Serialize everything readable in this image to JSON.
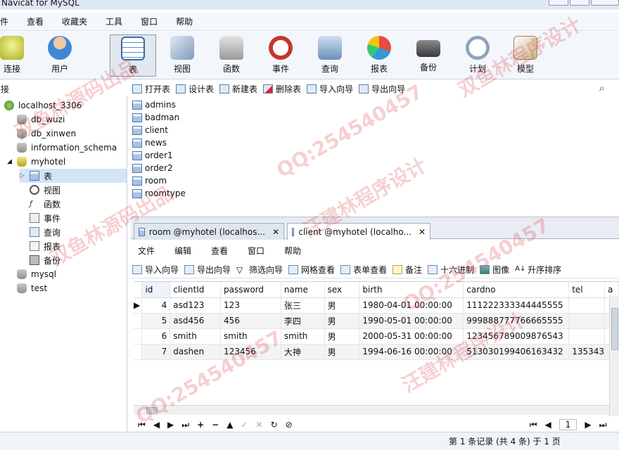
{
  "window": {
    "title": "Navicat for MySQL"
  },
  "menu": [
    "件",
    "查看",
    "收藏夹",
    "工具",
    "窗口",
    "帮助"
  ],
  "toolbar": [
    {
      "label": "连接",
      "icon": "connection-icon"
    },
    {
      "label": "用户",
      "icon": "user-icon"
    },
    {
      "label": "表",
      "icon": "table-icon",
      "active": true
    },
    {
      "label": "视图",
      "icon": "view-icon"
    },
    {
      "label": "函数",
      "icon": "function-icon"
    },
    {
      "label": "事件",
      "icon": "event-icon"
    },
    {
      "label": "查询",
      "icon": "query-icon"
    },
    {
      "label": "报表",
      "icon": "report-icon"
    },
    {
      "label": "备份",
      "icon": "backup-icon"
    },
    {
      "label": "计划",
      "icon": "schedule-icon"
    },
    {
      "label": "模型",
      "icon": "model-icon"
    }
  ],
  "left_title": "接",
  "tree": {
    "connection": "localhost_3306",
    "databases": [
      "db_wuzi",
      "db_xinwen",
      "information_schema",
      "myhotel",
      "mysql",
      "test"
    ],
    "myhotel_children": [
      "表",
      "视图",
      "函数",
      "事件",
      "查询",
      "报表",
      "备份"
    ]
  },
  "object_toolbar": [
    "打开表",
    "设计表",
    "新建表",
    "删除表",
    "导入向导",
    "导出向导"
  ],
  "tables": [
    "admins",
    "badman",
    "client",
    "news",
    "order1",
    "order2",
    "room",
    "roomtype"
  ],
  "tabs": [
    {
      "label": "room @myhotel (localhos...",
      "close": "✕"
    },
    {
      "label": "client @myhotel (localho...",
      "close": "✕"
    }
  ],
  "inner_menu": [
    "文件",
    "编辑",
    "查看",
    "窗口",
    "帮助"
  ],
  "inner_toolbar": [
    "导入向导",
    "导出向导",
    "筛选向导",
    "网格查看",
    "表单查看",
    "备注",
    "十六进制",
    "图像",
    "升序排序"
  ],
  "grid": {
    "columns": [
      "id",
      "clientId",
      "password",
      "name",
      "sex",
      "birth",
      "cardno",
      "tel",
      "a"
    ],
    "rows": [
      [
        "4",
        "asd123",
        "123",
        "张三",
        "男",
        "1980-04-01 00:00:00",
        "111222333344445555",
        ""
      ],
      [
        "5",
        "asd456",
        "456",
        "李四",
        "男",
        "1990-05-01 00:00:00",
        "999888777766665555",
        ""
      ],
      [
        "6",
        "smith",
        "smith",
        "smith",
        "男",
        "2000-05-31 00:00:00",
        "123456789009876543",
        ""
      ],
      [
        "7",
        "dashen",
        "123456",
        "大神",
        "男",
        "1994-06-16 00:00:00",
        "513030199406163432",
        "135343"
      ]
    ]
  },
  "nav": {
    "buttons": [
      "⏮",
      "◀",
      "▶",
      "⏭",
      "+",
      "−",
      "▲",
      "✓",
      "✕",
      "↻",
      "⊘"
    ],
    "page": "1"
  },
  "status": "第 1 条记录 (共 4 条) 于 1 页",
  "watermarks": [
    "双鱼林源码出品",
    "QQ:254540457",
    "汪建林程序设计",
    "双鱼林程序设计",
    "QQ:254540457",
    "汪建林程序设计",
    "QQ:254540457",
    "双鱼林源码出品"
  ]
}
